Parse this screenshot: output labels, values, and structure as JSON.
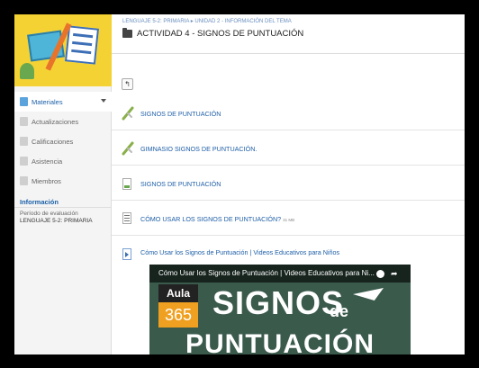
{
  "header": {
    "breadcrumb": "LENGUAJE 5-2: PRIMARIA ▸ UNIDAD 2 - INFORMACIÓN DEL TEMA",
    "title": "ACTIVIDAD 4 - SIGNOS DE PUNTUACIÓN"
  },
  "sidebar": {
    "items": [
      {
        "label": "Materiales"
      },
      {
        "label": "Actualizaciones"
      },
      {
        "label": "Calificaciones"
      },
      {
        "label": "Asistencia"
      },
      {
        "label": "Miembros"
      }
    ],
    "info_heading": "Información",
    "period_label": "Período de evaluación",
    "period_value": "LENGUAJE 5-2: PRIMARIA"
  },
  "materials": [
    {
      "title": "SIGNOS DE PUNTUACIÓN",
      "icon": "link-icon"
    },
    {
      "title": "GIMNASIO SIGNOS DE PUNTUACIÓN.",
      "icon": "link-icon"
    },
    {
      "title": "SIGNOS DE PUNTUACIÓN",
      "icon": "document-icon"
    },
    {
      "title": "CÓMO USAR LOS SIGNOS DE PUNTUACIÓN?",
      "size": "31 MB",
      "icon": "file-icon"
    },
    {
      "title": "Cómo Usar los Signos de Puntuación | Videos Educativos para Niños",
      "icon": "video-icon"
    }
  ],
  "video": {
    "title": "Cómo Usar los Signos de Puntuación | Videos Educativos para Ni...",
    "aula_top": "Aula",
    "aula_num": "365",
    "signos": "SIGNOS",
    "de": "de",
    "puntuacion": "PUNTUACIÓN"
  },
  "colors": {
    "link": "#2060a8",
    "banner": "#f5d233",
    "accent": "#5aa3dc"
  }
}
